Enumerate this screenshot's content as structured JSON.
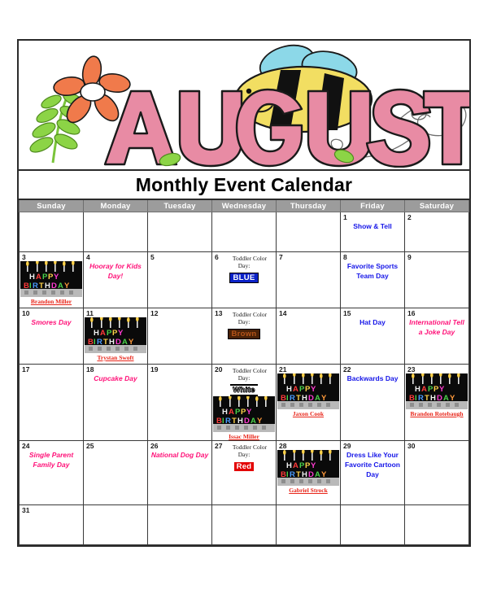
{
  "banner": {
    "month_title": "AUGUST",
    "decorations": [
      "flower-icon",
      "bee-icon",
      "leaf-vine-icon",
      "swirl-icon"
    ],
    "colors": {
      "letter_fill": "#e88ba4",
      "letter_outline": "#1a1a1a",
      "flower_petal": "#f07a4b",
      "flower_center": "#ffffff",
      "leaf": "#8cd446",
      "bee_body": "#f2de62",
      "bee_stripe": "#111111",
      "bee_wing": "#8cd8e8"
    }
  },
  "header": {
    "title": "Monthly Event Calendar",
    "weekdays": [
      "Sunday",
      "Monday",
      "Tuesday",
      "Wednesday",
      "Thursday",
      "Friday",
      "Saturday"
    ],
    "header_bg": "#9c9c9c",
    "header_text": "#ffffff"
  },
  "legend_colors": {
    "event_pink": "#ff1178",
    "event_blue": "#1616e8",
    "birthday_name": "#e8261a",
    "border": "#3a3a3a"
  },
  "weeks": [
    [
      {
        "day": ""
      },
      {
        "day": ""
      },
      {
        "day": ""
      },
      {
        "day": ""
      },
      {
        "day": ""
      },
      {
        "day": "1",
        "event": "Show & Tell",
        "event_color": "blue"
      },
      {
        "day": "2"
      }
    ],
    [
      {
        "day": "3",
        "birthday": "Brandon Miller"
      },
      {
        "day": "4",
        "event": "Hooray for Kids Day!",
        "event_color": "pink"
      },
      {
        "day": "5"
      },
      {
        "day": "6",
        "toddler_color_label": "Toddler Color Day:",
        "toddler_color": "BLUE",
        "swatch": "blue"
      },
      {
        "day": "7"
      },
      {
        "day": "8",
        "event": "Favorite Sports Team Day",
        "event_color": "blue"
      },
      {
        "day": "9"
      }
    ],
    [
      {
        "day": "10",
        "event": "Smores Day",
        "event_color": "pink"
      },
      {
        "day": "11",
        "birthday": "Trystan Swoft"
      },
      {
        "day": "12"
      },
      {
        "day": "13",
        "toddler_color_label": "Toddler Color Day:",
        "toddler_color": "Brown",
        "swatch": "brown"
      },
      {
        "day": "14"
      },
      {
        "day": "15",
        "event": "Hat Day",
        "event_color": "blue"
      },
      {
        "day": "16",
        "event": "International Tell a Joke Day",
        "event_color": "pink"
      }
    ],
    [
      {
        "day": "17"
      },
      {
        "day": "18",
        "event": "Cupcake Day",
        "event_color": "pink"
      },
      {
        "day": "19"
      },
      {
        "day": "20",
        "toddler_color_label": "Toddler Color Day:",
        "toddler_color": "White",
        "swatch": "white",
        "birthday": "Issac Miller"
      },
      {
        "day": "21",
        "birthday": "Jaxon Cook"
      },
      {
        "day": "22",
        "event": "Backwards Day",
        "event_color": "blue"
      },
      {
        "day": "23",
        "birthday": "Brandon Rotebaugh"
      }
    ],
    [
      {
        "day": "24",
        "event": "Single Parent Family Day",
        "event_color": "pink"
      },
      {
        "day": "25"
      },
      {
        "day": "26",
        "event": "National Dog Day",
        "event_color": "pink"
      },
      {
        "day": "27",
        "toddler_color_label": "Toddler Color Day:",
        "toddler_color": "Red",
        "swatch": "red"
      },
      {
        "day": "28",
        "birthday": "Gabriel Strock"
      },
      {
        "day": "29",
        "event": "Dress Like Your Favorite Cartoon Day",
        "event_color": "blue"
      },
      {
        "day": "30"
      }
    ],
    [
      {
        "day": "31"
      },
      {
        "day": ""
      },
      {
        "day": ""
      },
      {
        "day": ""
      },
      {
        "day": ""
      },
      {
        "day": ""
      },
      {
        "day": ""
      }
    ]
  ]
}
